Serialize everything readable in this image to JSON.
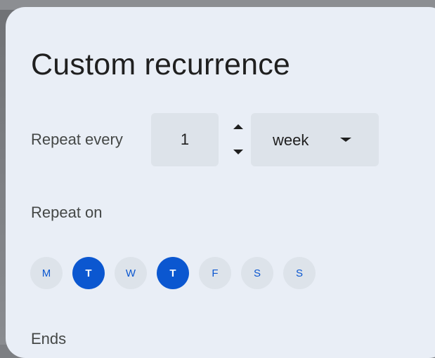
{
  "dialog": {
    "title": "Custom recurrence",
    "repeat_every": {
      "label": "Repeat every",
      "value": "1",
      "unit": "week",
      "stepper_up_icon": "arrow-up-icon",
      "stepper_down_icon": "arrow-down-icon",
      "dropdown_icon": "caret-down-icon"
    },
    "repeat_on": {
      "label": "Repeat on",
      "days": [
        {
          "label": "M",
          "selected": false
        },
        {
          "label": "T",
          "selected": true
        },
        {
          "label": "W",
          "selected": false
        },
        {
          "label": "T",
          "selected": true
        },
        {
          "label": "F",
          "selected": false
        },
        {
          "label": "S",
          "selected": false
        },
        {
          "label": "S",
          "selected": false
        }
      ]
    },
    "ends": {
      "label": "Ends"
    }
  },
  "colors": {
    "dialog_background": "#e9eef6",
    "field_background": "#dde3ea",
    "accent": "#0b57d0",
    "text": "#1f1f1f",
    "secondary_text": "#444746"
  }
}
